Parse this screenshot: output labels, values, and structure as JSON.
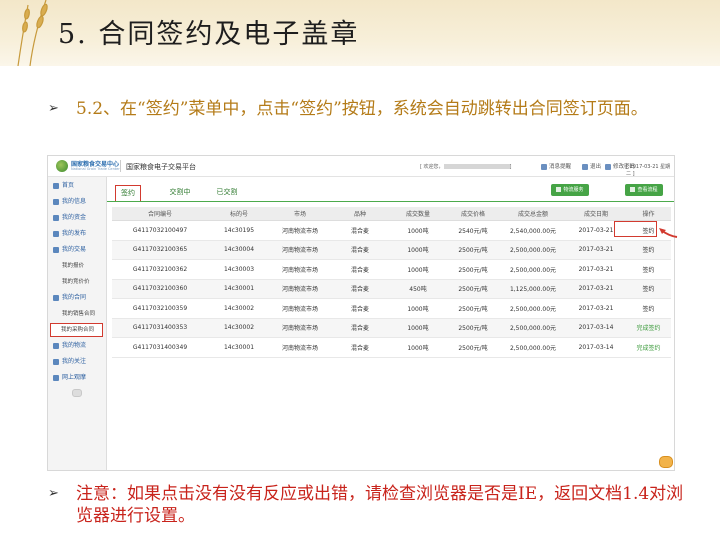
{
  "slide": {
    "title": "5. 合同签约及电子盖章",
    "bullet1": "5.2、在“签约”菜单中，点击“签约”按钮，系统会自动跳转出合同签订页面。",
    "bullet2": "注意：如果点击没有没有反应或出错，请检查浏览器是否是IE，返回文档1.4对浏览器进行设置。",
    "bullet_marker": "➢"
  },
  "app": {
    "logo_name": "国家粮食交易中心",
    "logo_sub": "National Grain Trade Center",
    "platform": "国家粮食电子交易平台",
    "welcome": "[ 欢迎您，",
    "welcome_end": "]",
    "links": [
      "消息提醒",
      "退出",
      "修改密码"
    ],
    "date": "[ 2017-03-21 星期二 ]"
  },
  "sidebar": {
    "items": [
      {
        "label": "首页",
        "type": "main"
      },
      {
        "label": "我的信息",
        "type": "main"
      },
      {
        "label": "我的资金",
        "type": "main"
      },
      {
        "label": "我的发布",
        "type": "main"
      },
      {
        "label": "我的交易",
        "type": "main"
      },
      {
        "label": "我的报价",
        "type": "sub"
      },
      {
        "label": "我的竞价价",
        "type": "sub"
      },
      {
        "label": "我的合同",
        "type": "main"
      },
      {
        "label": "我的销售合同",
        "type": "sub"
      },
      {
        "label": "我的采购合同",
        "type": "sub",
        "active": true
      },
      {
        "label": "我的物流",
        "type": "main"
      },
      {
        "label": "我的关注",
        "type": "main"
      },
      {
        "label": "网上观摩",
        "type": "main"
      }
    ]
  },
  "tabs": [
    {
      "label": "签约",
      "active": true
    },
    {
      "label": "交割中"
    },
    {
      "label": "已交割"
    }
  ],
  "actions": {
    "btn1": "物流服务",
    "btn2": "查看流程"
  },
  "table": {
    "columns": [
      "合同编号",
      "标的号",
      "市场",
      "品种",
      "成交数量",
      "成交价格",
      "成交总金额",
      "成交日期",
      "操作"
    ],
    "rows": [
      [
        "G4117032100497",
        "14c30195",
        "河南物流市场",
        "混合麦",
        "1000吨",
        "2540元/吨",
        "2,540,000.00元",
        "2017-03-21",
        "签约"
      ],
      [
        "G4117032100365",
        "14c30004",
        "河南物流市场",
        "混合麦",
        "1000吨",
        "2500元/吨",
        "2,500,000.00元",
        "2017-03-21",
        "签约"
      ],
      [
        "G4117032100362",
        "14c30003",
        "河南物流市场",
        "混合麦",
        "1000吨",
        "2500元/吨",
        "2,500,000.00元",
        "2017-03-21",
        "签约"
      ],
      [
        "G4117032100360",
        "14c30001",
        "河南物流市场",
        "混合麦",
        "450吨",
        "2500元/吨",
        "1,125,000.00元",
        "2017-03-21",
        "签约"
      ],
      [
        "G4117032100359",
        "14c30002",
        "河南物流市场",
        "混合麦",
        "1000吨",
        "2500元/吨",
        "2,500,000.00元",
        "2017-03-21",
        "签约"
      ],
      [
        "G4117031400353",
        "14c30002",
        "河南物流市场",
        "混合麦",
        "1000吨",
        "2500元/吨",
        "2,500,000.00元",
        "2017-03-14",
        "完成签约"
      ],
      [
        "G4117031400349",
        "14c30001",
        "河南物流市场",
        "混合麦",
        "1000吨",
        "2500元/吨",
        "2,500,000.00元",
        "2017-03-14",
        "完成签约"
      ]
    ]
  },
  "colors": {
    "accent_green": "#46a446",
    "highlight_red": "#d23a2f",
    "link_blue": "#2a57b0",
    "title_gold": "#b47b18",
    "note_red": "#c8231b"
  }
}
